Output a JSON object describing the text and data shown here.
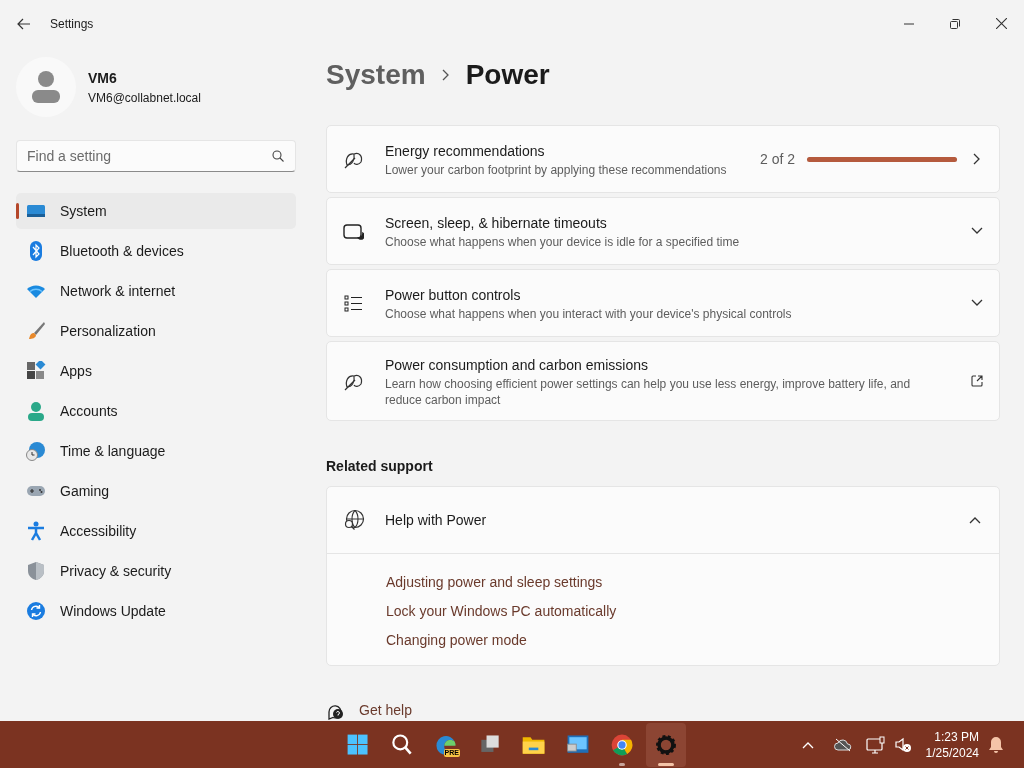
{
  "window": {
    "title": "Settings"
  },
  "user": {
    "name": "VM6",
    "email": "VM6@collabnet.local"
  },
  "search": {
    "placeholder": "Find a setting"
  },
  "nav": [
    {
      "label": "System",
      "selected": true
    },
    {
      "label": "Bluetooth & devices",
      "selected": false
    },
    {
      "label": "Network & internet",
      "selected": false
    },
    {
      "label": "Personalization",
      "selected": false
    },
    {
      "label": "Apps",
      "selected": false
    },
    {
      "label": "Accounts",
      "selected": false
    },
    {
      "label": "Time & language",
      "selected": false
    },
    {
      "label": "Gaming",
      "selected": false
    },
    {
      "label": "Accessibility",
      "selected": false
    },
    {
      "label": "Privacy & security",
      "selected": false
    },
    {
      "label": "Windows Update",
      "selected": false
    }
  ],
  "breadcrumb": [
    "System",
    "Power"
  ],
  "cards": [
    {
      "kind": "progress",
      "title": "Energy recommendations",
      "description": "Lower your carbon footprint by applying these recommendations",
      "count": "2 of 2",
      "level": 1
    },
    {
      "kind": "expander",
      "title": "Screen, sleep, & hibernate timeouts",
      "description": "Choose what happens when your device is idle for a specified time",
      "expanded": false
    },
    {
      "kind": "expander",
      "title": "Power button controls",
      "description": "Choose what happens when you interact with your device's physical controls",
      "expanded": false
    },
    {
      "kind": "external",
      "title": "Power consumption and carbon emissions",
      "description": "Learn how choosing efficient power settings can help you use less energy, improve battery life, and reduce carbon impact"
    }
  ],
  "related_support": {
    "heading": "Related support",
    "title": "Help with Power",
    "expanded": true,
    "links": [
      "Adjusting power and sleep settings",
      "Lock your Windows PC automatically",
      "Changing power mode"
    ]
  },
  "get_help": "Get help",
  "taskbar": {
    "apps": [
      {
        "kind": "start",
        "running": false,
        "selected": false
      },
      {
        "kind": "search",
        "running": false,
        "selected": false
      },
      {
        "kind": "edge",
        "badge": "PRE",
        "running": false,
        "selected": false
      },
      {
        "kind": "taskview",
        "running": false,
        "selected": false
      },
      {
        "kind": "explorer",
        "running": false,
        "selected": false
      },
      {
        "kind": "rdp",
        "running": false,
        "selected": false
      },
      {
        "kind": "chrome",
        "running": true,
        "selected": false
      },
      {
        "kind": "settings",
        "running": true,
        "selected": true
      }
    ],
    "time": "1:23 PM",
    "date": "1/25/2024"
  }
}
